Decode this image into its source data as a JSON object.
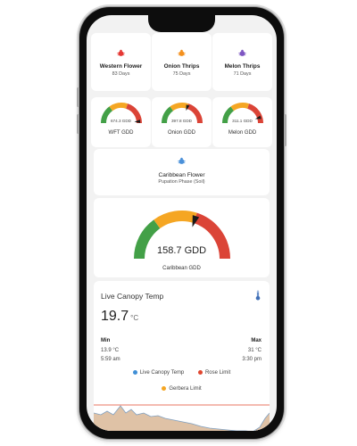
{
  "colors": {
    "gauge_green": "#43a047",
    "gauge_amber": "#f5a623",
    "gauge_red": "#db4437",
    "pest_orange": "#f4911e",
    "pest_red": "#e53935",
    "pest_purple": "#7e57c2",
    "info_blue": "#4a90d9"
  },
  "pests": [
    {
      "name": "Western Flower",
      "days": "83 Days",
      "icon": "bug-icon-red"
    },
    {
      "name": "Onion Thrips",
      "days": "75 Days",
      "icon": "bug-icon-orange"
    },
    {
      "name": "Melon Thrips",
      "days": "71 Days",
      "icon": "bug-icon-purple"
    }
  ],
  "gauges": [
    {
      "value": "674.3 GDD",
      "label": "WFT GDD",
      "fraction": 0.97
    },
    {
      "value": "397.8 GDD",
      "label": "Onion GDD",
      "fraction": 0.6
    },
    {
      "value": "311.1 GDD",
      "label": "Melon GDD",
      "fraction": 0.9
    }
  ],
  "caribbean": {
    "name": "Caribbean Flower",
    "phase": "Pupation Phase (Soil)",
    "icon": "bug-icon-blue",
    "gauge_value": "158.7 GDD",
    "gauge_label": "Caribbean GDD",
    "gauge_fraction": 0.6
  },
  "temp": {
    "title": "Live Canopy Temp",
    "value": "19.7",
    "unit": "°C",
    "min_label": "Min",
    "min_value": "13.9 °C",
    "min_time": "5:59 am",
    "max_label": "Max",
    "max_value": "31 °C",
    "max_time": "3:30 pm",
    "legend": [
      {
        "label": "Live Canopy Temp",
        "color": "#3f8fd6"
      },
      {
        "label": "Rose Limit",
        "color": "#e0462f"
      },
      {
        "label": "Gerbera Limit",
        "color": "#f5a623"
      }
    ]
  }
}
